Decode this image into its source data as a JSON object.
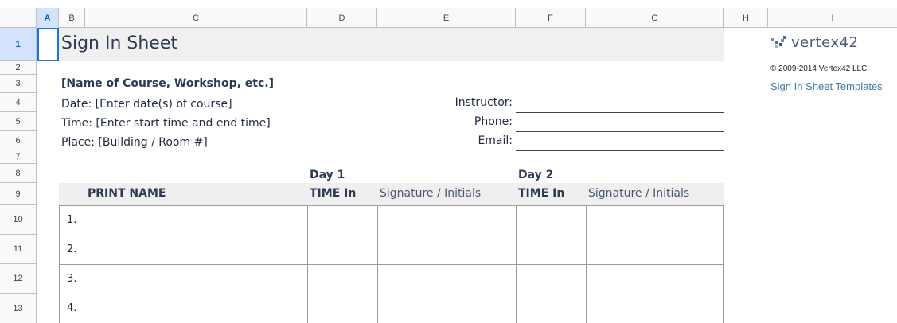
{
  "sheet": {
    "columns": [
      "A",
      "B",
      "C",
      "D",
      "E",
      "F",
      "G",
      "H",
      "I"
    ],
    "selected_column": "A",
    "rows": [
      "1",
      "2",
      "3",
      "4",
      "5",
      "6",
      "7",
      "8",
      "9",
      "10",
      "11",
      "12",
      "13"
    ],
    "selected_row": "1"
  },
  "document": {
    "title": "Sign In Sheet",
    "course_name": "[Name of Course, Workshop, etc.]",
    "date_line": "Date: [Enter date(s) of course]",
    "time_line": "Time: [Enter start time and end time]",
    "place_line": "Place: [Building / Room #]",
    "instructor_label": "Instructor:",
    "phone_label": "Phone:",
    "email_label": "Email:"
  },
  "table": {
    "day1_label": "Day 1",
    "day2_label": "Day 2",
    "print_name_header": "PRINT NAME",
    "time_in_header": "TIME In",
    "signature_header": "Signature / Initials",
    "row_numbers": [
      "1.",
      "2.",
      "3.",
      "4."
    ]
  },
  "sidebar": {
    "logo_text": "vertex42",
    "copyright": "© 2009-2014 Vertex42 LLC",
    "templates_link": "Sign In Sheet Templates"
  },
  "colors": {
    "title_band": "#f0f0f0",
    "header_band": "#efefef",
    "text": "#1f2a44",
    "link": "#3a7ca5",
    "selection": "#d3e3fd"
  }
}
